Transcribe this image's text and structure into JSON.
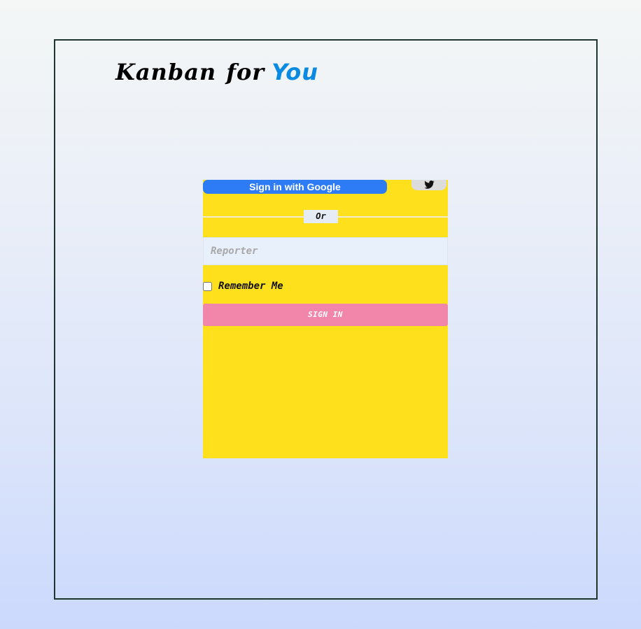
{
  "brand": {
    "word1": "Kanban",
    "word2": "for",
    "word3": "You",
    "accent_color": "#0a8ae0"
  },
  "login": {
    "google_button_label": "Sign in with Google",
    "twitter_icon": "twitter-bird-icon",
    "divider_label": "Or",
    "reporter_placeholder": "Reporter",
    "reporter_value": "",
    "remember_label": "Remember Me",
    "remember_checked": false,
    "signin_label": "SIGN IN",
    "colors": {
      "card_background": "#ffe01c",
      "google_button": "#2e7cf5",
      "signin_button": "#f286aa"
    }
  }
}
